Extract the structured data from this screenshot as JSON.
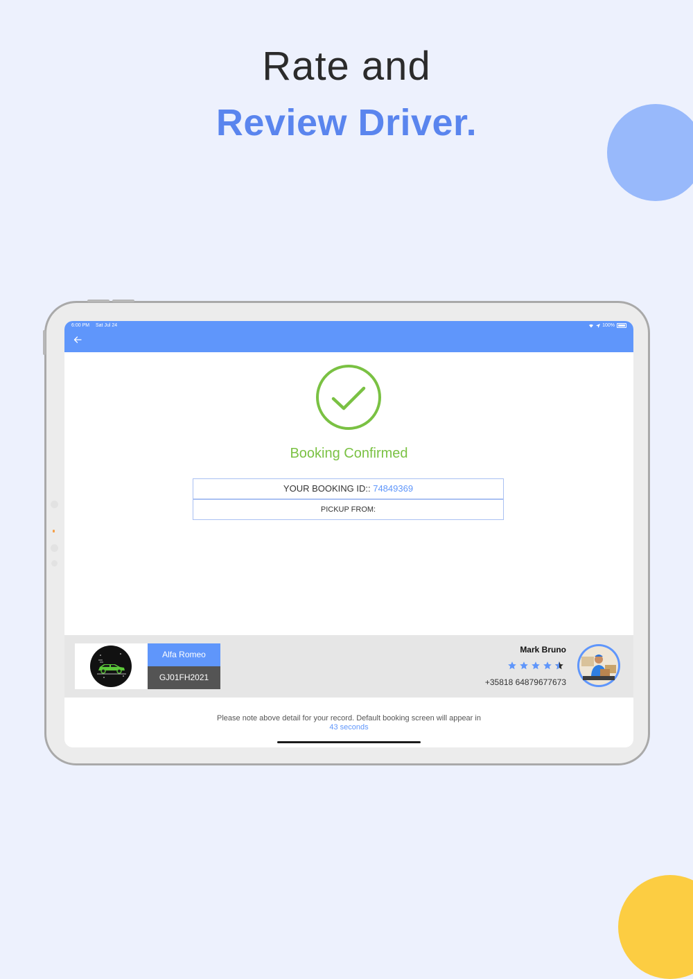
{
  "promo": {
    "line1": "Rate and",
    "line2": "Review Driver."
  },
  "status_bar": {
    "time": "6:00 PM",
    "date": "Sat Jul 24",
    "battery": "100%"
  },
  "booking": {
    "title": "Booking Confirmed",
    "id_label": "YOUR BOOKING ID:: ",
    "id_value": "74849369",
    "pickup_label": "PICKUP FROM:"
  },
  "vehicle": {
    "name": "Alfa Romeo",
    "plate": "GJ01FH2021"
  },
  "driver": {
    "name": "Mark Bruno",
    "rating": 4.5,
    "rating_max": 5,
    "phone": "+35818 64879677673"
  },
  "footer": {
    "note": "Please note above detail for your record. Default booking screen will appear in",
    "countdown": "43 seconds"
  },
  "colors": {
    "primary": "#5f96fb",
    "success": "#7ac143",
    "accent_heading": "#5a85ee"
  }
}
